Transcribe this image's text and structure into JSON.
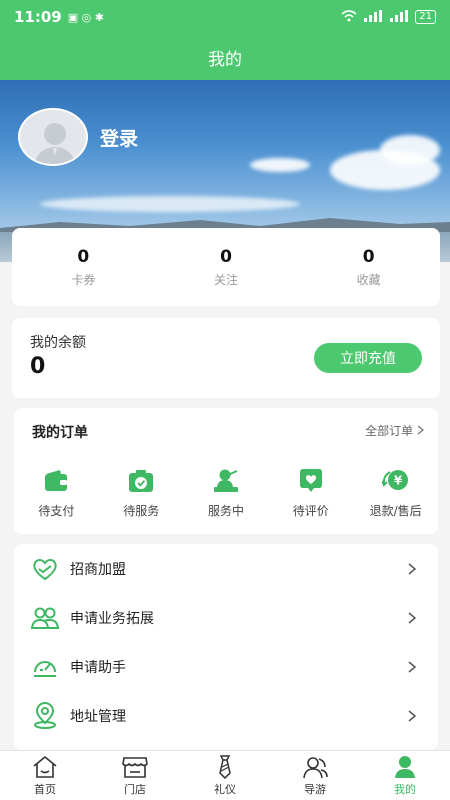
{
  "status_bar": {
    "time": "11:09",
    "battery": "21"
  },
  "title": "我的",
  "profile": {
    "login_label": "登录"
  },
  "stats": [
    {
      "value": "0",
      "label": "卡券"
    },
    {
      "value": "0",
      "label": "关注"
    },
    {
      "value": "0",
      "label": "收藏"
    }
  ],
  "balance": {
    "label": "我的余额",
    "value": "0",
    "recharge_label": "立即充值"
  },
  "orders": {
    "title": "我的订单",
    "all_label": "全部订单",
    "items": [
      {
        "label": "待支付",
        "icon": "wallet-icon"
      },
      {
        "label": "待服务",
        "icon": "camera-icon"
      },
      {
        "label": "服务中",
        "icon": "person-desk-icon"
      },
      {
        "label": "待评价",
        "icon": "heart-bubble-icon"
      },
      {
        "label": "退款/售后",
        "icon": "yen-refund-icon"
      }
    ]
  },
  "menu": [
    {
      "label": "招商加盟",
      "icon": "handshake-heart-icon"
    },
    {
      "label": "申请业务拓展",
      "icon": "people-icon"
    },
    {
      "label": "申请助手",
      "icon": "speedometer-icon"
    },
    {
      "label": "地址管理",
      "icon": "location-pin-icon"
    }
  ],
  "tabs": [
    {
      "label": "首页",
      "icon": "home-icon",
      "active": false
    },
    {
      "label": "门店",
      "icon": "store-icon",
      "active": false
    },
    {
      "label": "礼仪",
      "icon": "tie-icon",
      "active": false
    },
    {
      "label": "导游",
      "icon": "guide-icon",
      "active": false
    },
    {
      "label": "我的",
      "icon": "user-icon",
      "active": true
    }
  ],
  "colors": {
    "accent": "#4cc86f"
  }
}
